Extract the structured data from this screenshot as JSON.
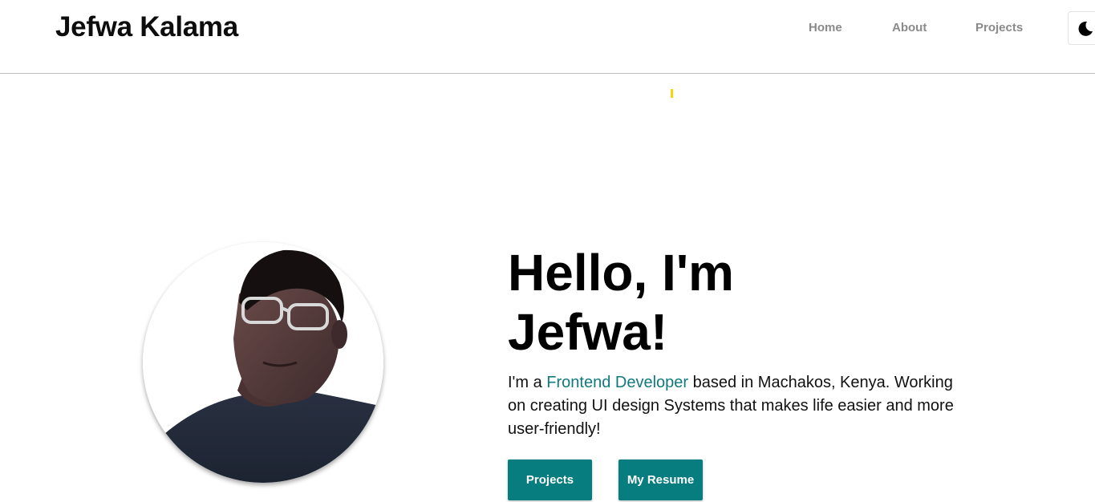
{
  "header": {
    "brand": "Jefwa Kalama",
    "nav": [
      {
        "label": "Home"
      },
      {
        "label": "About"
      },
      {
        "label": "Projects"
      }
    ],
    "theme_toggle_icon": "moon-icon"
  },
  "hero": {
    "title_line1": "Hello, I'm",
    "title_line2": "Jefwa!",
    "desc_prefix": "I'm a ",
    "desc_role": "Frontend Developer",
    "desc_suffix": " based in Machakos, Kenya. Working on creating UI design Systems that makes life easier and more user-friendly!",
    "buttons": {
      "projects": "Projects",
      "resume": "My Resume"
    }
  },
  "colors": {
    "accent": "#087d80",
    "role_text": "#117a7e",
    "nav_text": "#8a8a8a",
    "highlight": "#f4d60a"
  }
}
